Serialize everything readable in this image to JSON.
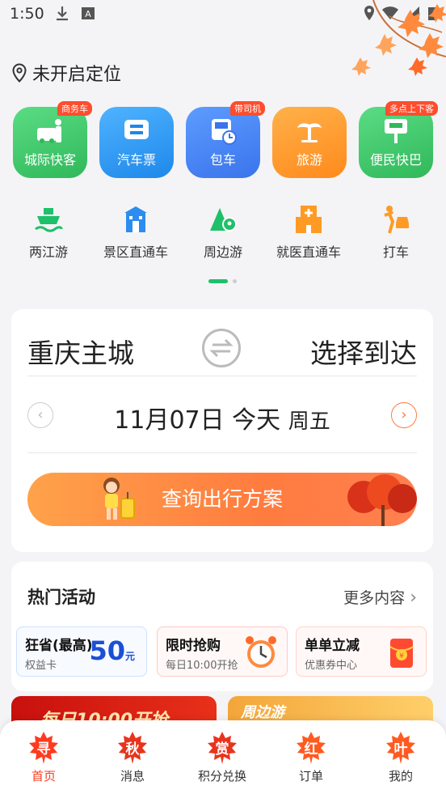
{
  "status_bar": {
    "time": "1:50"
  },
  "location": {
    "label": "未开启定位"
  },
  "services_row1": [
    {
      "label": "城际快客",
      "badge": "商务车",
      "color": "#3ec96d"
    },
    {
      "label": "汽车票",
      "badge": "",
      "color": "#2d9cf4"
    },
    {
      "label": "包车",
      "badge": "带司机",
      "color": "#3f86f5"
    },
    {
      "label": "旅游",
      "badge": "",
      "color": "#ff9320"
    },
    {
      "label": "便民快巴",
      "badge": "多点上下客",
      "color": "#3ec96d"
    }
  ],
  "services_row2": [
    {
      "label": "两江游"
    },
    {
      "label": "景区直通车"
    },
    {
      "label": "周边游"
    },
    {
      "label": "就医直通车"
    },
    {
      "label": "打车"
    }
  ],
  "search": {
    "from": "重庆主城",
    "to": "选择到达",
    "date": "11月07日 今天",
    "weekday": "周五",
    "query_button": "查询出行方案"
  },
  "activities": {
    "title": "热门活动",
    "more": "更多内容",
    "coupons": [
      {
        "main": "狂省(最高)",
        "sub": "权益卡",
        "amount": "50",
        "unit": "元"
      },
      {
        "main": "限时抢购",
        "sub": "每日10:00开抢"
      },
      {
        "main": "单单立减",
        "sub": "优惠券中心"
      }
    ],
    "banners": [
      {
        "text": "每日10:00开抢"
      },
      {
        "text": "周边游"
      }
    ]
  },
  "bottom_nav": [
    {
      "icon_char": "寻",
      "label": "首页",
      "active": true
    },
    {
      "icon_char": "秋",
      "label": "消息",
      "active": false
    },
    {
      "icon_char": "赏",
      "label": "积分兑换",
      "active": false
    },
    {
      "icon_char": "红",
      "label": "订单",
      "active": false
    },
    {
      "icon_char": "叶",
      "label": "我的",
      "active": false
    }
  ]
}
